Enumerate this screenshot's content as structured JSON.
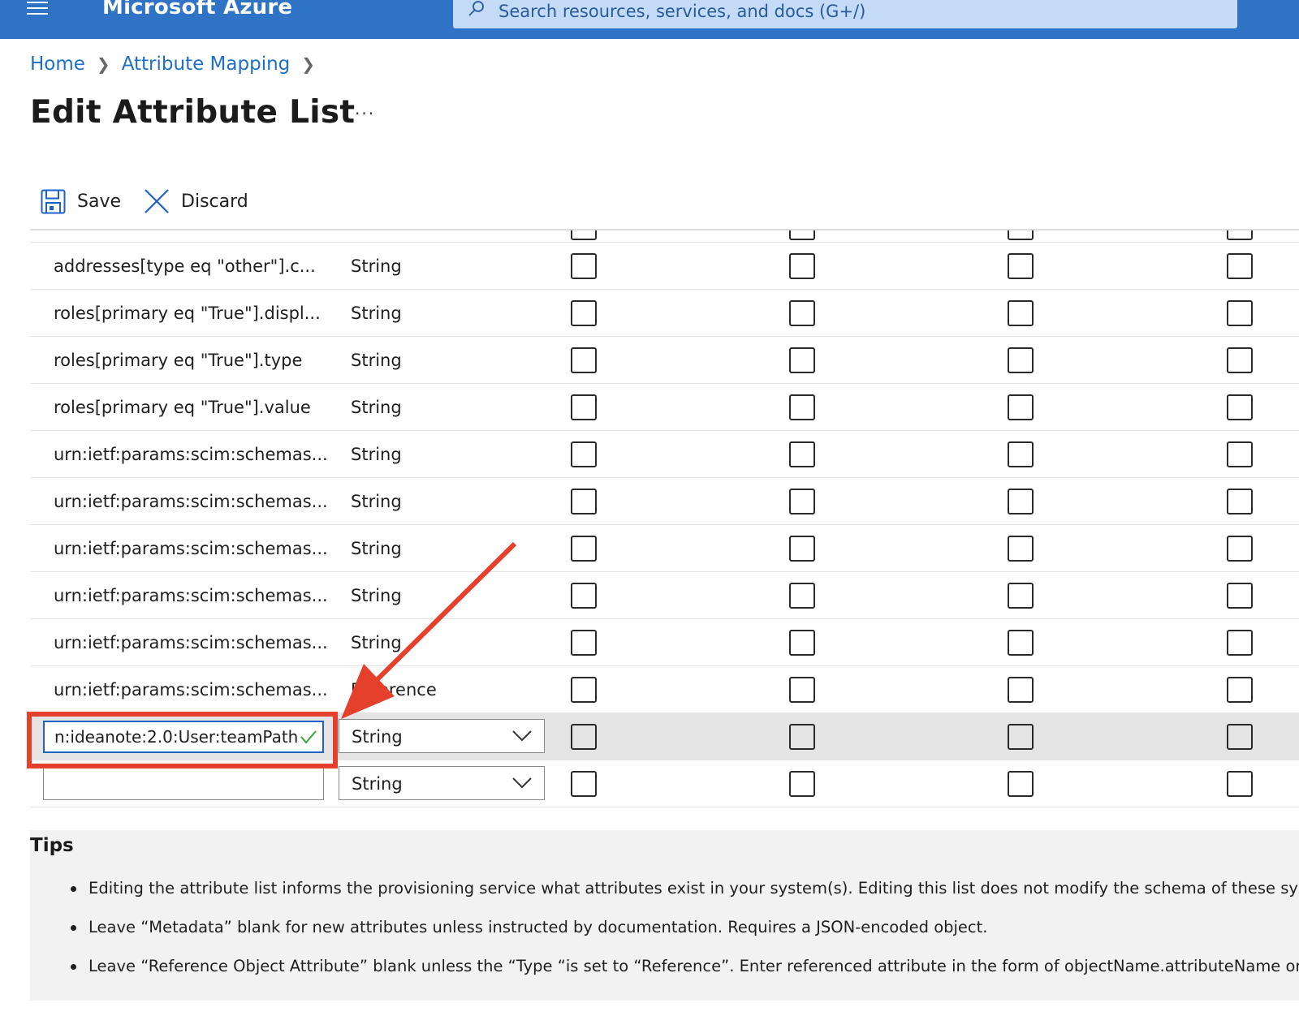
{
  "header": {
    "brand": "Microsoft Azure",
    "search_placeholder": "Search resources, services, and docs (G+/)",
    "accent": "#2f73c7"
  },
  "breadcrumb": [
    {
      "label": "Home"
    },
    {
      "label": "Attribute Mapping"
    }
  ],
  "page": {
    "title": "Edit Attribute List",
    "more": "···"
  },
  "toolbar": {
    "save_label": "Save",
    "discard_label": "Discard"
  },
  "rows": [
    {
      "name": "addresses[type eq \"other\"].c...",
      "type": "String"
    },
    {
      "name": "roles[primary eq \"True\"].displ...",
      "type": "String"
    },
    {
      "name": "roles[primary eq \"True\"].type",
      "type": "String"
    },
    {
      "name": "roles[primary eq \"True\"].value",
      "type": "String"
    },
    {
      "name": "urn:ietf:params:scim:schemas...",
      "type": "String"
    },
    {
      "name": "urn:ietf:params:scim:schemas...",
      "type": "String"
    },
    {
      "name": "urn:ietf:params:scim:schemas...",
      "type": "String"
    },
    {
      "name": "urn:ietf:params:scim:schemas...",
      "type": "String"
    },
    {
      "name": "urn:ietf:params:scim:schemas...",
      "type": "String"
    },
    {
      "name": "urn:ietf:params:scim:schemas...",
      "type": "Reference"
    }
  ],
  "editing_row": {
    "name_value": "n:ideanote:2.0:User:teamPath",
    "type_value": "String"
  },
  "new_row": {
    "name_value": "",
    "type_value": "String"
  },
  "tips": {
    "heading": "Tips",
    "items": [
      "Editing the attribute list informs the provisioning service what attributes exist in your system(s). Editing this list does not modify the schema of these syst",
      "Leave “Metadata” blank for new attributes unless instructed by documentation. Requires a JSON-encoded object.",
      "Leave “Reference Object Attribute” blank unless the “Type “is set to “Reference”. Enter referenced attribute in the form of objectName.attributeName or"
    ]
  },
  "annotation_color": "#e5402b"
}
